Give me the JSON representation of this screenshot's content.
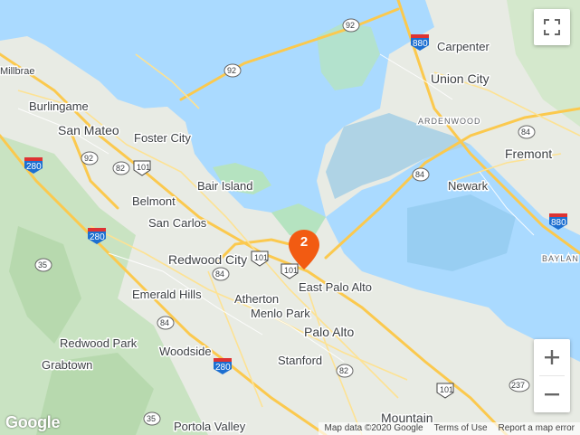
{
  "map": {
    "places": {
      "millbrae": "Millbrae",
      "burlingame": "Burlingame",
      "san_mateo": "San Mateo",
      "foster_city": "Foster City",
      "belmont": "Belmont",
      "san_carlos": "San Carlos",
      "bair_island": "Bair Island",
      "redwood_city": "Redwood City",
      "emerald_hills": "Emerald Hills",
      "atherton": "Atherton",
      "menlo_park": "Menlo Park",
      "east_palo_alto": "East Palo Alto",
      "palo_alto": "Palo Alto",
      "stanford": "Stanford",
      "redwood_park": "Redwood Park",
      "woodside": "Woodside",
      "grabtown": "Grabtown",
      "portola_valley": "Portola Valley",
      "mountain_view": "Mountain",
      "union_city": "Union City",
      "carpenter": "Carpenter",
      "ardenwood": "ARDENWOOD",
      "fremont": "Fremont",
      "newark": "Newark",
      "baylands": "BAYLAN"
    },
    "shields": {
      "us101_a": "101",
      "us101_b": "101",
      "us101_c": "101",
      "us101_d": "101",
      "i280_a": "280",
      "i280_b": "280",
      "i280_c": "280",
      "i880_a": "880",
      "i880_b": "880",
      "ca92_a": "92",
      "ca92_b": "92",
      "ca92_c": "92",
      "ca82_a": "82",
      "ca82_b": "82",
      "ca84_a": "84",
      "ca84_b": "84",
      "ca84_c": "84",
      "ca84_d": "84",
      "ca35_a": "35",
      "ca35_b": "35",
      "ca237": "237"
    },
    "cluster": {
      "count": "2",
      "color": "#f25b12"
    },
    "colors": {
      "water": "#aadaff",
      "land": "#e8ebe4",
      "park": "#c5e6c0",
      "road": "#ffd37a",
      "marsh": "#b5e3c0"
    }
  },
  "controls": {
    "fullscreen_icon": "fullscreen-icon",
    "zoom_in_icon": "plus-icon",
    "zoom_out_icon": "minus-icon"
  },
  "footer": {
    "logo": "Google",
    "map_data": "Map data ©2020 Google",
    "terms": "Terms of Use",
    "report": "Report a map error"
  }
}
